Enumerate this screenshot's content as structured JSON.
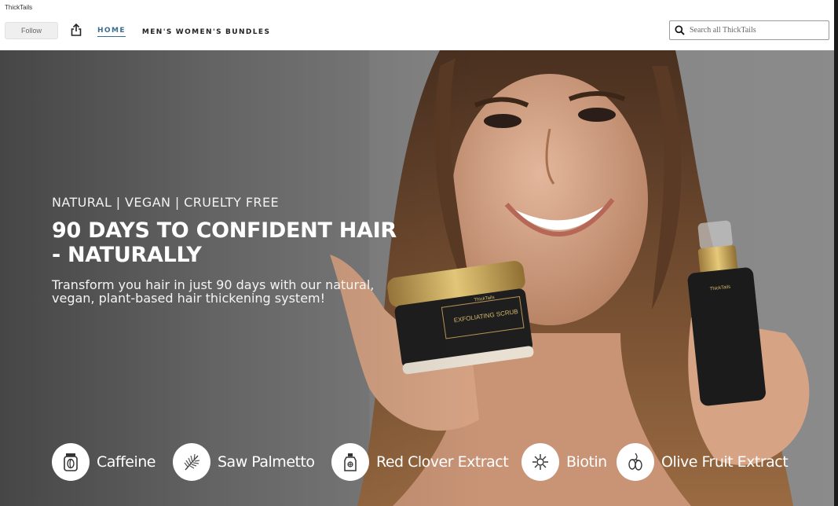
{
  "header": {
    "store_name": "ThickTails",
    "follow_label": "Follow",
    "share_icon": "share-icon",
    "nav": [
      {
        "label": "HOME",
        "active": true
      },
      {
        "label": "MEN'S",
        "active": false
      },
      {
        "label": "WOMEN'S",
        "active": false
      },
      {
        "label": "BUNDLES",
        "active": false
      }
    ],
    "search": {
      "placeholder": "Search all ThickTails",
      "icon": "search-icon"
    }
  },
  "hero": {
    "tagline": "NATURAL | VEGAN | CRUELTY FREE",
    "headline": "90 DAYS TO CONFIDENT HAIR - NATURALLY",
    "subtext": "Transform you hair in just 90 days with our natural, vegan, plant-based hair thickening system!",
    "products": {
      "jar_brand": "ThickTails",
      "jar_label": "EXFOLIATING SCRUB",
      "bottle_brand": "ThickTails"
    },
    "ingredients": [
      {
        "label": "Caffeine",
        "icon": "caffeine-icon"
      },
      {
        "label": "Saw Palmetto",
        "icon": "saw-palmetto-icon"
      },
      {
        "label": "Red Clover Extract",
        "icon": "red-clover-icon"
      },
      {
        "label": "Biotin",
        "icon": "biotin-icon"
      },
      {
        "label": "Olive Fruit Extract",
        "icon": "olive-fruit-icon"
      }
    ]
  },
  "colors": {
    "nav_active": "#3a6e8f",
    "hero_background": "#858585",
    "hero_text": "#ffffff"
  }
}
